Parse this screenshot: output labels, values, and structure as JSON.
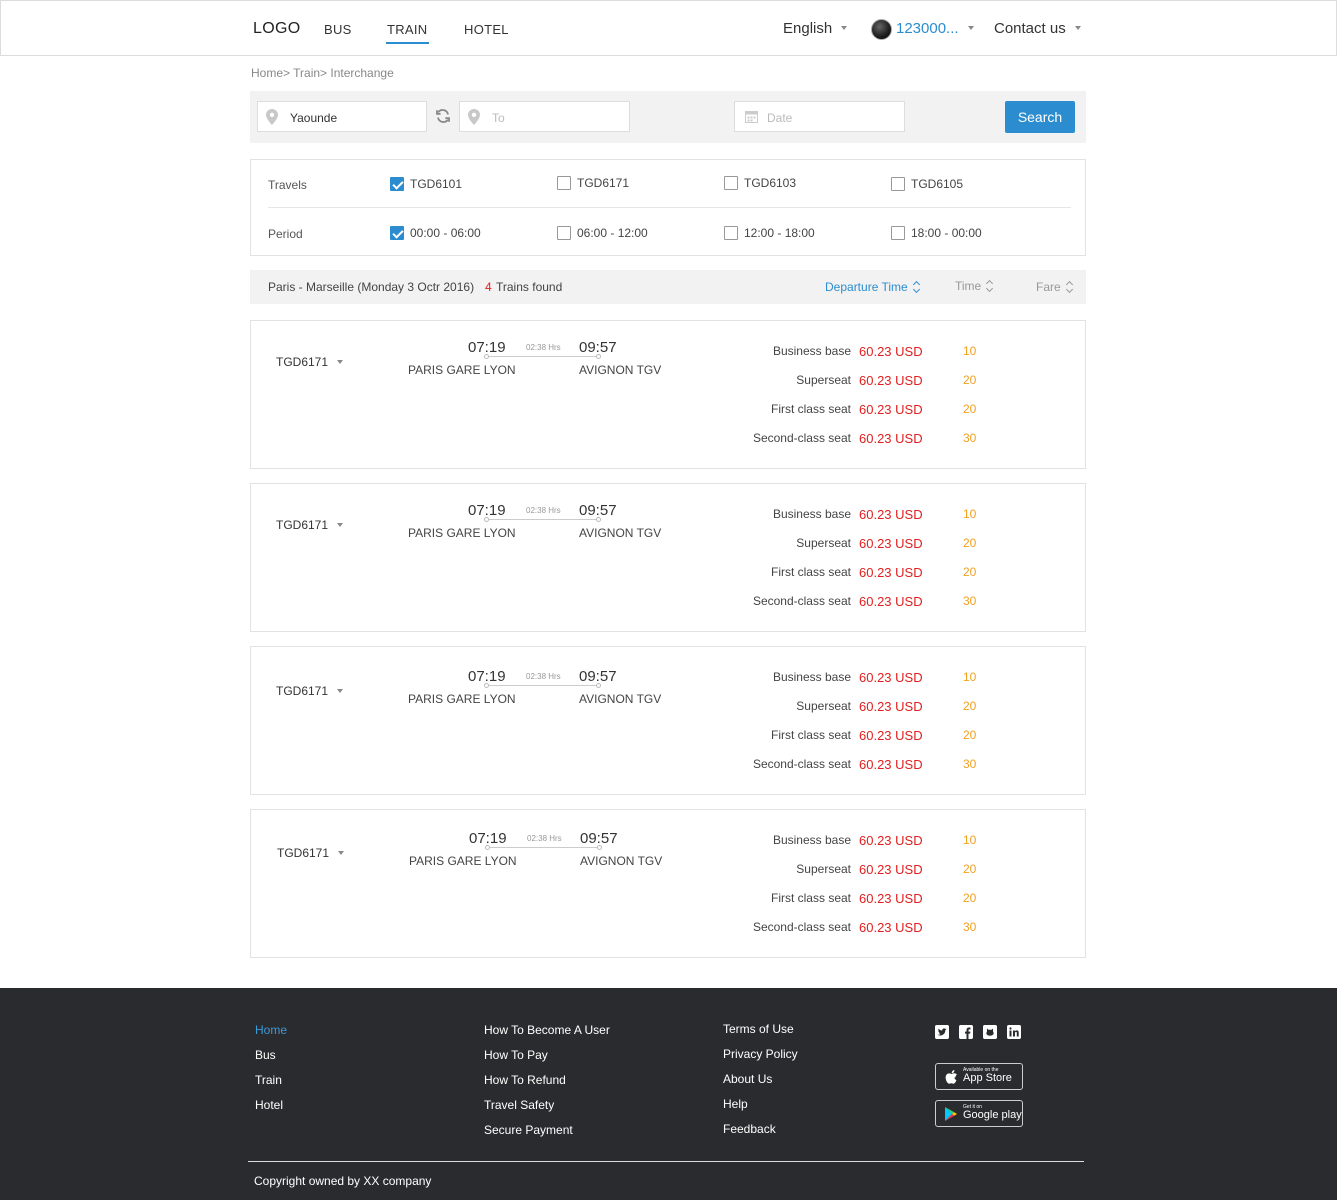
{
  "header": {
    "logo": "LOGO",
    "nav": [
      {
        "label": "BUS",
        "active": false
      },
      {
        "label": "TRAIN",
        "active": true
      },
      {
        "label": "HOTEL",
        "active": false
      }
    ],
    "language": "English",
    "user_id": "123000...",
    "contact": "Contact us"
  },
  "breadcrumb": "Home> Train> Interchange",
  "search": {
    "from_value": "Yaounde",
    "to_placeholder": "To",
    "date_placeholder": "Date",
    "button": "Search"
  },
  "filters": {
    "travels_label": "Travels",
    "travels": [
      {
        "label": "TGD6101",
        "checked": true
      },
      {
        "label": "TGD6171",
        "checked": false
      },
      {
        "label": "TGD6103",
        "checked": false
      },
      {
        "label": "TGD6105",
        "checked": false
      }
    ],
    "period_label": "Period",
    "periods": [
      {
        "label": "00:00 - 06:00",
        "checked": true
      },
      {
        "label": "06:00 - 12:00",
        "checked": false
      },
      {
        "label": "12:00 - 18:00",
        "checked": false
      },
      {
        "label": "18:00 - 00:00",
        "checked": false
      }
    ]
  },
  "results": {
    "route": "Paris - Marseille (Monday 3 Octr  2016)",
    "count": "4",
    "found_text": "Trains found",
    "sort_departure": "Departure Time",
    "sort_time": "Time",
    "sort_fare": "Fare"
  },
  "trains": [
    {
      "id": "TGD6171",
      "dep_time": "07:19",
      "arr_time": "09:57",
      "duration": "02:38 Hrs",
      "dep_station": "PARIS GARE LYON",
      "arr_station": "AVIGNON TGV",
      "fares": [
        {
          "class": "Business base",
          "price": "60.23 USD",
          "qty": "10"
        },
        {
          "class": "Superseat",
          "price": "60.23 USD",
          "qty": "20"
        },
        {
          "class": "First class seat",
          "price": "60.23 USD",
          "qty": "20"
        },
        {
          "class": "Second-class seat",
          "price": "60.23 USD",
          "qty": "30"
        }
      ]
    },
    {
      "id": "TGD6171",
      "dep_time": "07:19",
      "arr_time": "09:57",
      "duration": "02:38 Hrs",
      "dep_station": "PARIS GARE LYON",
      "arr_station": "AVIGNON TGV",
      "fares": [
        {
          "class": "Business base",
          "price": "60.23 USD",
          "qty": "10"
        },
        {
          "class": "Superseat",
          "price": "60.23 USD",
          "qty": "20"
        },
        {
          "class": "First class seat",
          "price": "60.23 USD",
          "qty": "20"
        },
        {
          "class": "Second-class seat",
          "price": "60.23 USD",
          "qty": "30"
        }
      ]
    },
    {
      "id": "TGD6171",
      "dep_time": "07:19",
      "arr_time": "09:57",
      "duration": "02:38 Hrs",
      "dep_station": "PARIS GARE LYON",
      "arr_station": "AVIGNON TGV",
      "fares": [
        {
          "class": "Business base",
          "price": "60.23 USD",
          "qty": "10"
        },
        {
          "class": "Superseat",
          "price": "60.23 USD",
          "qty": "20"
        },
        {
          "class": "First class seat",
          "price": "60.23 USD",
          "qty": "20"
        },
        {
          "class": "Second-class seat",
          "price": "60.23 USD",
          "qty": "30"
        }
      ]
    },
    {
      "id": "TGD6171",
      "dep_time": "07:19",
      "arr_time": "09:57",
      "duration": "02:38 Hrs",
      "dep_station": "PARIS GARE LYON",
      "arr_station": "AVIGNON TGV",
      "fares": [
        {
          "class": "Business base",
          "price": "60.23 USD",
          "qty": "10"
        },
        {
          "class": "Superseat",
          "price": "60.23 USD",
          "qty": "20"
        },
        {
          "class": "First class seat",
          "price": "60.23 USD",
          "qty": "20"
        },
        {
          "class": "Second-class seat",
          "price": "60.23 USD",
          "qty": "30"
        }
      ]
    }
  ],
  "footer": {
    "col1": [
      "Home",
      "Bus",
      "Train",
      "Hotel"
    ],
    "col2": [
      "How To Become A User",
      "How To Pay",
      "How To Refund",
      "Travel Safety",
      "Secure Payment"
    ],
    "col3": [
      "Terms of Use",
      "Privacy Policy",
      "About Us",
      "Help",
      "Feedback"
    ],
    "social_icons": [
      "twitter-icon",
      "facebook-icon",
      "github-icon",
      "linkedin-icon"
    ],
    "appstore_small": "Available on the",
    "appstore_big": "App Store",
    "googleplay_small": "Get it on",
    "googleplay_big": "Google play",
    "copyright": "Copyright owned by XX company"
  },
  "colors": {
    "accent": "#2b8dd0",
    "price": "#e02020",
    "qty": "#f0a020",
    "footer_bg": "#2a2b2e"
  }
}
